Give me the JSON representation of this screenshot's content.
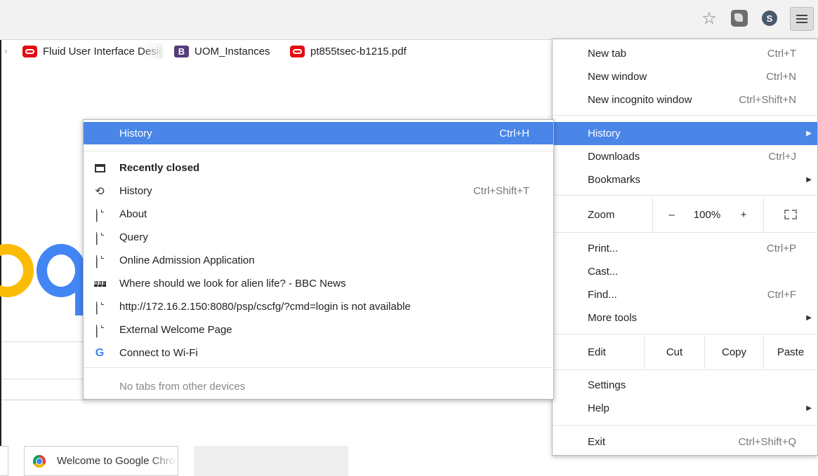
{
  "bookmarks": [
    {
      "label": "Fluid User Interface Design",
      "icon": "oracle-icon"
    },
    {
      "label": "UOM_Instances",
      "icon": "bootstrap-b-icon"
    },
    {
      "label": "pt855tsec-b1215.pdf",
      "icon": "oracle-icon"
    }
  ],
  "toolbar": {
    "star": "☆",
    "ext_glyph": "S",
    "menu_title": "Customize and control"
  },
  "main_menu": {
    "new_tab": {
      "label": "New tab",
      "shortcut": "Ctrl+T"
    },
    "new_window": {
      "label": "New window",
      "shortcut": "Ctrl+N"
    },
    "new_incognito": {
      "label": "New incognito window",
      "shortcut": "Ctrl+Shift+N"
    },
    "history": {
      "label": "History"
    },
    "downloads": {
      "label": "Downloads",
      "shortcut": "Ctrl+J"
    },
    "bookmarks": {
      "label": "Bookmarks"
    },
    "zoom": {
      "label": "Zoom",
      "minus": "–",
      "value": "100%",
      "plus": "+"
    },
    "print": {
      "label": "Print...",
      "shortcut": "Ctrl+P"
    },
    "cast": {
      "label": "Cast..."
    },
    "find": {
      "label": "Find...",
      "shortcut": "Ctrl+F"
    },
    "more_tools": {
      "label": "More tools"
    },
    "edit": {
      "label": "Edit",
      "cut": "Cut",
      "copy": "Copy",
      "paste": "Paste"
    },
    "settings": {
      "label": "Settings"
    },
    "help": {
      "label": "Help"
    },
    "exit": {
      "label": "Exit",
      "shortcut": "Ctrl+Shift+Q"
    }
  },
  "history_menu": {
    "header": {
      "label": "History",
      "shortcut": "Ctrl+H"
    },
    "recently_closed": "Recently closed",
    "items": [
      {
        "label": "History",
        "shortcut": "Ctrl+Shift+T"
      },
      {
        "label": "About",
        "shortcut": ""
      },
      {
        "label": "Query",
        "shortcut": ""
      },
      {
        "label": "Online Admission Application",
        "shortcut": ""
      },
      {
        "label": "Where should we look for alien life? - BBC News",
        "shortcut": ""
      },
      {
        "label": "http://172.16.2.150:8080/psp/cscfg/?cmd=login is not available",
        "shortcut": ""
      },
      {
        "label": "External Welcome Page",
        "shortcut": ""
      },
      {
        "label": "Connect to Wi-Fi",
        "shortcut": ""
      }
    ],
    "other_devices": "No tabs from other devices"
  },
  "page": {
    "tile_label": "Welcome to Google Chrome"
  }
}
